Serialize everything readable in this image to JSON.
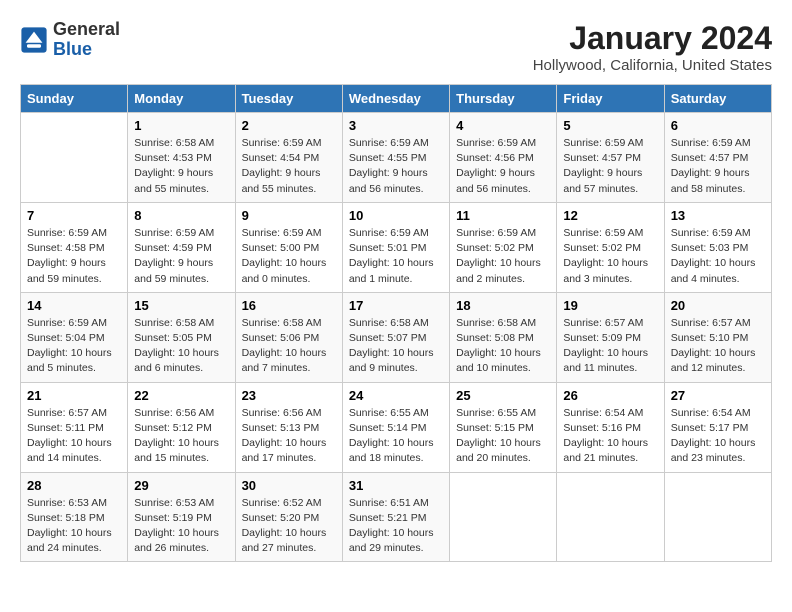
{
  "header": {
    "logo_general": "General",
    "logo_blue": "Blue",
    "month_year": "January 2024",
    "location": "Hollywood, California, United States"
  },
  "columns": [
    "Sunday",
    "Monday",
    "Tuesday",
    "Wednesday",
    "Thursday",
    "Friday",
    "Saturday"
  ],
  "weeks": [
    [
      {
        "day": "",
        "info": ""
      },
      {
        "day": "1",
        "info": "Sunrise: 6:58 AM\nSunset: 4:53 PM\nDaylight: 9 hours\nand 55 minutes."
      },
      {
        "day": "2",
        "info": "Sunrise: 6:59 AM\nSunset: 4:54 PM\nDaylight: 9 hours\nand 55 minutes."
      },
      {
        "day": "3",
        "info": "Sunrise: 6:59 AM\nSunset: 4:55 PM\nDaylight: 9 hours\nand 56 minutes."
      },
      {
        "day": "4",
        "info": "Sunrise: 6:59 AM\nSunset: 4:56 PM\nDaylight: 9 hours\nand 56 minutes."
      },
      {
        "day": "5",
        "info": "Sunrise: 6:59 AM\nSunset: 4:57 PM\nDaylight: 9 hours\nand 57 minutes."
      },
      {
        "day": "6",
        "info": "Sunrise: 6:59 AM\nSunset: 4:57 PM\nDaylight: 9 hours\nand 58 minutes."
      }
    ],
    [
      {
        "day": "7",
        "info": "Sunrise: 6:59 AM\nSunset: 4:58 PM\nDaylight: 9 hours\nand 59 minutes."
      },
      {
        "day": "8",
        "info": "Sunrise: 6:59 AM\nSunset: 4:59 PM\nDaylight: 9 hours\nand 59 minutes."
      },
      {
        "day": "9",
        "info": "Sunrise: 6:59 AM\nSunset: 5:00 PM\nDaylight: 10 hours\nand 0 minutes."
      },
      {
        "day": "10",
        "info": "Sunrise: 6:59 AM\nSunset: 5:01 PM\nDaylight: 10 hours\nand 1 minute."
      },
      {
        "day": "11",
        "info": "Sunrise: 6:59 AM\nSunset: 5:02 PM\nDaylight: 10 hours\nand 2 minutes."
      },
      {
        "day": "12",
        "info": "Sunrise: 6:59 AM\nSunset: 5:02 PM\nDaylight: 10 hours\nand 3 minutes."
      },
      {
        "day": "13",
        "info": "Sunrise: 6:59 AM\nSunset: 5:03 PM\nDaylight: 10 hours\nand 4 minutes."
      }
    ],
    [
      {
        "day": "14",
        "info": "Sunrise: 6:59 AM\nSunset: 5:04 PM\nDaylight: 10 hours\nand 5 minutes."
      },
      {
        "day": "15",
        "info": "Sunrise: 6:58 AM\nSunset: 5:05 PM\nDaylight: 10 hours\nand 6 minutes."
      },
      {
        "day": "16",
        "info": "Sunrise: 6:58 AM\nSunset: 5:06 PM\nDaylight: 10 hours\nand 7 minutes."
      },
      {
        "day": "17",
        "info": "Sunrise: 6:58 AM\nSunset: 5:07 PM\nDaylight: 10 hours\nand 9 minutes."
      },
      {
        "day": "18",
        "info": "Sunrise: 6:58 AM\nSunset: 5:08 PM\nDaylight: 10 hours\nand 10 minutes."
      },
      {
        "day": "19",
        "info": "Sunrise: 6:57 AM\nSunset: 5:09 PM\nDaylight: 10 hours\nand 11 minutes."
      },
      {
        "day": "20",
        "info": "Sunrise: 6:57 AM\nSunset: 5:10 PM\nDaylight: 10 hours\nand 12 minutes."
      }
    ],
    [
      {
        "day": "21",
        "info": "Sunrise: 6:57 AM\nSunset: 5:11 PM\nDaylight: 10 hours\nand 14 minutes."
      },
      {
        "day": "22",
        "info": "Sunrise: 6:56 AM\nSunset: 5:12 PM\nDaylight: 10 hours\nand 15 minutes."
      },
      {
        "day": "23",
        "info": "Sunrise: 6:56 AM\nSunset: 5:13 PM\nDaylight: 10 hours\nand 17 minutes."
      },
      {
        "day": "24",
        "info": "Sunrise: 6:55 AM\nSunset: 5:14 PM\nDaylight: 10 hours\nand 18 minutes."
      },
      {
        "day": "25",
        "info": "Sunrise: 6:55 AM\nSunset: 5:15 PM\nDaylight: 10 hours\nand 20 minutes."
      },
      {
        "day": "26",
        "info": "Sunrise: 6:54 AM\nSunset: 5:16 PM\nDaylight: 10 hours\nand 21 minutes."
      },
      {
        "day": "27",
        "info": "Sunrise: 6:54 AM\nSunset: 5:17 PM\nDaylight: 10 hours\nand 23 minutes."
      }
    ],
    [
      {
        "day": "28",
        "info": "Sunrise: 6:53 AM\nSunset: 5:18 PM\nDaylight: 10 hours\nand 24 minutes."
      },
      {
        "day": "29",
        "info": "Sunrise: 6:53 AM\nSunset: 5:19 PM\nDaylight: 10 hours\nand 26 minutes."
      },
      {
        "day": "30",
        "info": "Sunrise: 6:52 AM\nSunset: 5:20 PM\nDaylight: 10 hours\nand 27 minutes."
      },
      {
        "day": "31",
        "info": "Sunrise: 6:51 AM\nSunset: 5:21 PM\nDaylight: 10 hours\nand 29 minutes."
      },
      {
        "day": "",
        "info": ""
      },
      {
        "day": "",
        "info": ""
      },
      {
        "day": "",
        "info": ""
      }
    ]
  ]
}
